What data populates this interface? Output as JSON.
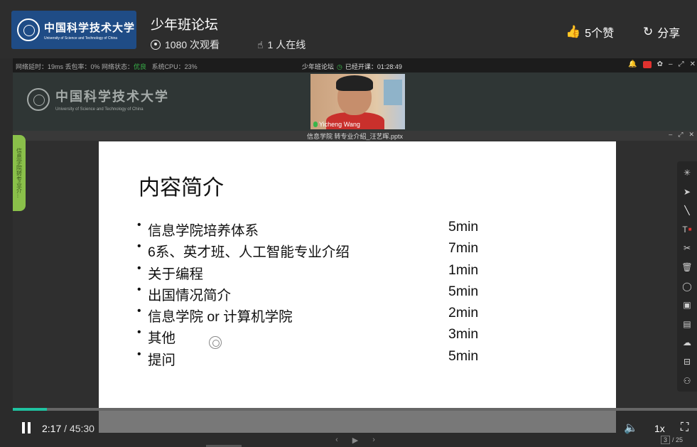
{
  "header": {
    "logo_cn": "中国科学技术大学",
    "logo_en": "University of Science and Technology of China",
    "title": "少年班论坛",
    "views": "1080 次观看",
    "online": "1 人在线",
    "likes": "5个赞",
    "share": "分享"
  },
  "classroom_bar": {
    "net_status_prefix": "网络延时：19ms  丢包率：0%  网络状态：",
    "net_status_value": "优良",
    "cpu": "系统CPU：23%",
    "room_title": "少年班论坛",
    "elapsed": "已经开课：01:28:49"
  },
  "board": {
    "logo_cn": "中国科学技术大学",
    "logo_en": "University of Science and Technology of China",
    "webcam_name": "Yicheng Wang"
  },
  "document": {
    "filename": "信息学院 转专业介绍_汪艺晖.pptx",
    "side_tab": "信息学院转专业介..."
  },
  "slide": {
    "title": "内容简介",
    "items": [
      {
        "label": "信息学院培养体系",
        "duration": "5min"
      },
      {
        "label": "6系、英才班、人工智能专业介绍",
        "duration": "7min"
      },
      {
        "label": "关于编程",
        "duration": "1min"
      },
      {
        "label": "出国情况简介",
        "duration": "5min"
      },
      {
        "label": "信息学院 or 计算机学院",
        "duration": "2min"
      },
      {
        "label": "其他",
        "duration": "3min"
      },
      {
        "label": "提问",
        "duration": "5min"
      }
    ]
  },
  "tools": [
    "magic-pointer",
    "select",
    "pen",
    "text",
    "scissors",
    "eraser",
    "laser",
    "formula",
    "comment",
    "cloud",
    "toolbox",
    "group"
  ],
  "player": {
    "current_time": "2:17",
    "total_time": "45:30",
    "speed": "1x",
    "progress": 0.05,
    "page_current": "3",
    "page_total": "/ 25"
  },
  "colors": {
    "accent": "#1fc3a1",
    "good": "#39b54a",
    "like": "#6bd36b",
    "logo_bg": "#1f4c86"
  }
}
